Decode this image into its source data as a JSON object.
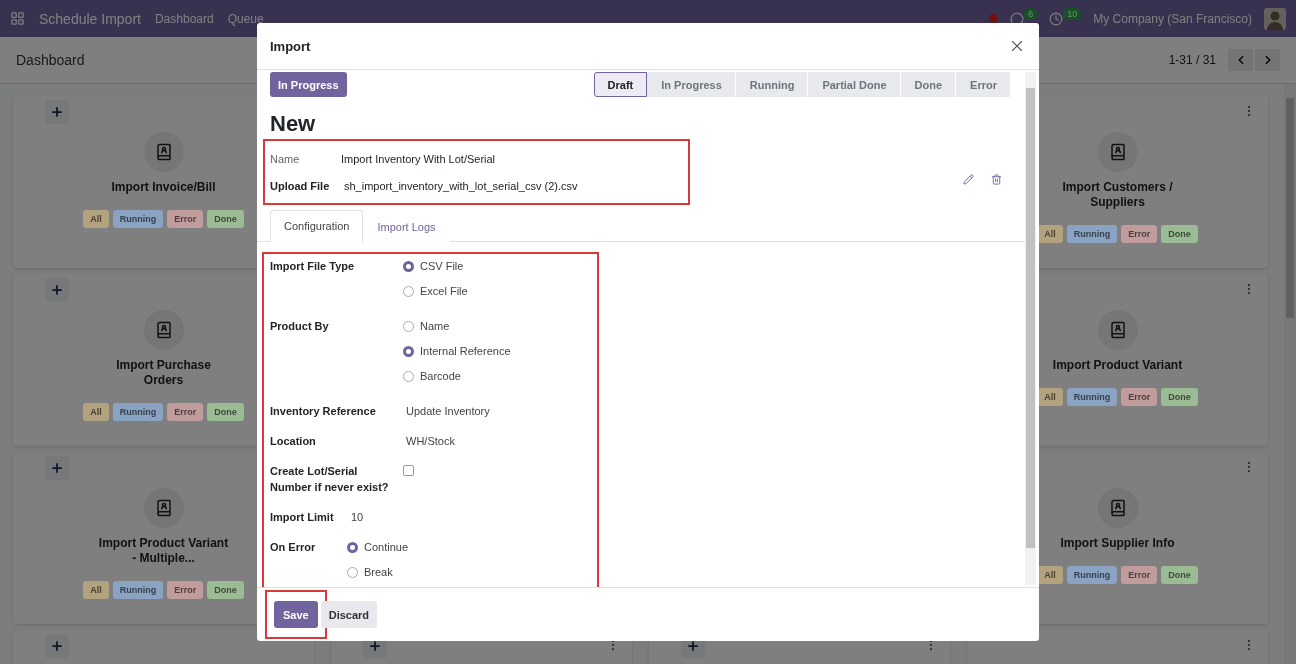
{
  "navbar": {
    "app_name": "Schedule Import",
    "menu": [
      "Dashboard",
      "Queue"
    ],
    "chat_count": "6",
    "activity_count": "10",
    "company": "My Company (San Francisco)"
  },
  "control_panel": {
    "breadcrumb": "Dashboard",
    "pager": "1-31 / 31"
  },
  "dashboard": {
    "left_cards": [
      {
        "title": "Import Invoice/Bill",
        "badges": [
          {
            "label": "All",
            "color": "#b3a27e"
          },
          {
            "label": "Running",
            "color": "#8aa3c2"
          },
          {
            "label": "Error",
            "color": "#c19c9c"
          },
          {
            "label": "Done",
            "color": "#9bbb94"
          }
        ]
      },
      {
        "title": "Import Purchase Orders",
        "badges": [
          {
            "label": "All",
            "color": "#b3a27e"
          },
          {
            "label": "Running",
            "color": "#8aa3c2"
          },
          {
            "label": "Error",
            "color": "#c19c9c"
          },
          {
            "label": "Done",
            "color": "#9bbb94"
          }
        ]
      },
      {
        "title": "Import Product Variant - Multiple...",
        "badges": [
          {
            "label": "All",
            "color": "#b3a27e"
          },
          {
            "label": "Running",
            "color": "#8aa3c2"
          },
          {
            "label": "Error",
            "color": "#c19c9c"
          },
          {
            "label": "Done",
            "color": "#9bbb94"
          }
        ]
      }
    ],
    "right_cards": [
      {
        "title": "Import Customers / Suppliers",
        "badges": [
          {
            "label": "All",
            "color": "#b3a27e"
          },
          {
            "label": "Running",
            "color": "#8aa3c2"
          },
          {
            "label": "Error",
            "color": "#c19c9c"
          },
          {
            "label": "Done",
            "color": "#9bbb94"
          }
        ]
      },
      {
        "title": "Import Product Variant",
        "badges": [
          {
            "label": "All",
            "color": "#b3a27e"
          },
          {
            "label": "Running",
            "color": "#8aa3c2"
          },
          {
            "label": "Error",
            "color": "#c19c9c"
          },
          {
            "label": "Done",
            "color": "#9bbb94"
          }
        ]
      },
      {
        "title": "Import Supplier Info",
        "badges": [
          {
            "label": "All",
            "color": "#b3a27e"
          },
          {
            "label": "Running",
            "color": "#8aa3c2"
          },
          {
            "label": "Error",
            "color": "#c19c9c"
          },
          {
            "label": "Done",
            "color": "#9bbb94"
          }
        ]
      }
    ]
  },
  "dialog": {
    "title": "Import",
    "action_button": "In Progress",
    "stages": [
      {
        "label": "Draft",
        "selected": true
      },
      {
        "label": "In Progress",
        "selected": false
      },
      {
        "label": "Running",
        "selected": false
      },
      {
        "label": "Partial Done",
        "selected": false
      },
      {
        "label": "Done",
        "selected": false
      },
      {
        "label": "Error",
        "selected": false
      }
    ],
    "record_title": "New",
    "main_fields": [
      {
        "kind": "text",
        "label": "Name",
        "value": "Import Inventory With Lot/Serial",
        "required": false
      },
      {
        "kind": "file",
        "label": "Upload File",
        "value": "sh_import_inventory_with_lot_serial_csv (2).csv",
        "required": true
      }
    ],
    "tabs": [
      {
        "label": "Configuration",
        "selected": true
      },
      {
        "label": "Import Logs",
        "selected": false
      }
    ],
    "config_groups": [
      {
        "fields": [
          {
            "kind": "radio",
            "label": "Import File Type",
            "options": [
              {
                "label": "CSV File",
                "selected": true
              },
              {
                "label": "Excel File",
                "selected": false
              }
            ]
          },
          {
            "kind": "radio",
            "label": "Product By",
            "options": [
              {
                "label": "Name",
                "selected": false
              },
              {
                "label": "Internal Reference",
                "selected": true
              },
              {
                "label": "Barcode",
                "selected": false
              }
            ]
          },
          {
            "kind": "text",
            "label": "Inventory Reference",
            "value": "Update Inventory"
          },
          {
            "kind": "text",
            "label": "Location",
            "value": "WH/Stock"
          },
          {
            "kind": "checkbox",
            "label": "Create Lot/Serial Number if never exist?",
            "checked": false
          }
        ]
      },
      {
        "fields": [
          {
            "kind": "text",
            "label": "Import Limit",
            "value": "10"
          },
          {
            "kind": "radio",
            "label": "On Error",
            "options": [
              {
                "label": "Continue",
                "selected": true
              },
              {
                "label": "Break",
                "selected": false
              }
            ]
          }
        ]
      }
    ],
    "buttons": [
      {
        "label": "Save",
        "primary": true
      },
      {
        "label": "Discard",
        "primary": false
      }
    ]
  }
}
